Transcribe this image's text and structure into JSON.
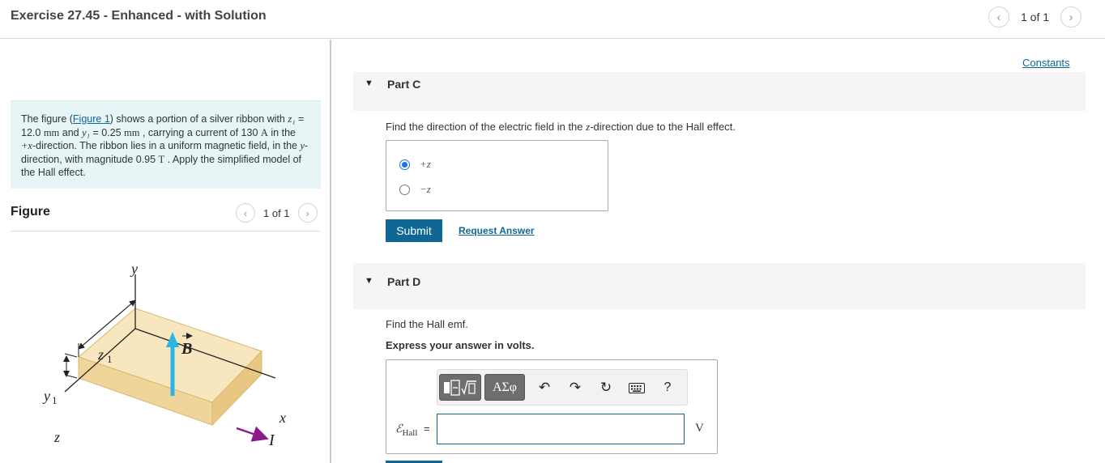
{
  "header": {
    "title": "Exercise 27.45 - Enhanced - with Solution",
    "pager": "1 of 1"
  },
  "problem": {
    "p1": "The figure (",
    "link": "Figure 1",
    "p2": ") shows a portion of a silver ribbon with ",
    "z1": "z₁",
    "p3": " = 12.0 ",
    "mm": "mm",
    "p4": " and ",
    "y1": "y₁",
    "p5": " = 0.25 ",
    "mm2": "mm",
    "p6": " , carrying a current of 130 ",
    "A": "A",
    "p7": " in the ",
    "plusx": "+x",
    "p8": "-direction. The ribbon lies in a uniform magnetic field, in the ",
    "y": "y",
    "p9": "-direction, with magnitude 0.95 ",
    "T": "T",
    "p10": " . Apply the simplified model of the Hall effect."
  },
  "figure_panel": {
    "title": "Figure",
    "pager": "1 of 1",
    "labels": {
      "y": "y",
      "B": "B",
      "z1": "z",
      "z1_sub": "1",
      "y1": "y",
      "y1_sub": "1",
      "x": "x",
      "z": "z",
      "I": "I"
    }
  },
  "constants_link": "Constants",
  "part_c": {
    "label": "Part C",
    "prompt_a": "Find the direction of the electric field in the ",
    "prompt_z": "z",
    "prompt_b": "-direction due to the Hall effect.",
    "options": [
      "+z",
      "−z"
    ],
    "selected": 0,
    "submit": "Submit",
    "request": "Request Answer"
  },
  "part_d": {
    "label": "Part D",
    "prompt": "Find the Hall emf.",
    "instruction": "Express your answer in volts.",
    "toolbar": {
      "greek": "ΑΣφ",
      "help": "?"
    },
    "eq_label": "ℰ",
    "eq_sub": "Hall",
    "eq_equals": "=",
    "input_value": "",
    "unit": "V"
  },
  "colors": {
    "accent": "#0e6794",
    "panel_bg": "#e7f5f7",
    "ribbon": "#f3dfb0",
    "field_arrow": "#29b6e6",
    "current_arrow": "#8b1a8b"
  }
}
